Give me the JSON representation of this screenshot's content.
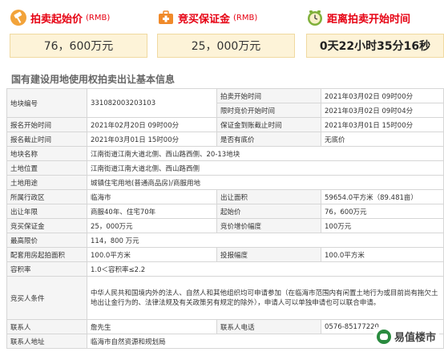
{
  "cards": [
    {
      "label": "拍卖起始价",
      "sub": "(RMB)",
      "value": "76，600万元",
      "icon": "gavel-icon"
    },
    {
      "label": "竞买保证金",
      "sub": "(RMB)",
      "value": "25，000万元",
      "icon": "medical-kit-icon"
    },
    {
      "label": "距离拍卖开始时间",
      "sub": "",
      "value": "0天22小时35分16秒",
      "icon": "clock-icon"
    }
  ],
  "section_title": "国有建设用地使用权拍卖出让基本信息",
  "rows": [
    {
      "k1": "地块编号",
      "v1": "331082003203103",
      "k2": "拍卖开始时间",
      "v2": "2021年03月02日 09时00分"
    },
    {
      "k1": "",
      "v1": "",
      "k2": "限时竞价开始时间",
      "v2": "2021年03月02日 09时04分"
    },
    {
      "k1": "报名开始时间",
      "v1": "2021年02月20日 09时00分",
      "k2": "保证金到账截止时间",
      "v2": "2021年03月01日 15时00分"
    },
    {
      "k1": "报名截止时间",
      "v1": "2021年03月01日 15时00分",
      "k2": "是否有底价",
      "v2": "无底价"
    },
    {
      "k1": "地块名称",
      "v1": "江南街道江南大道北侧、西山路西侧、20-13地块"
    },
    {
      "k1": "土地位置",
      "v1": "江南街道江南大道北侧、西山路西侧"
    },
    {
      "k1": "土地用途",
      "v1": "城镇住宅用地(普通商品房)/商服用地"
    },
    {
      "k1": "所属行政区",
      "v1": "临海市",
      "k2": "出让面积",
      "v2": "59654.0平方米（89.481亩）"
    },
    {
      "k1": "出让年限",
      "v1": "商服40年、住宅70年",
      "k2": "起始价",
      "v2": "76，600万元"
    },
    {
      "k1": "竞买保证金",
      "v1": "25，000万元",
      "k2": "竞价增价幅度",
      "v2": "100万元"
    },
    {
      "k1": "最高限价",
      "v1": "114，800 万元"
    },
    {
      "k1": "配套用房起拍面积",
      "v1": "100.0平方米",
      "k2": "投报幅度",
      "v2": "100.0平方米"
    },
    {
      "k1": "容积率",
      "v1": "1.0＜容积率≤2.2"
    },
    {
      "k1": "竞买人条件",
      "v1": "中华人民共和国境内外的法人、自然人和其他组织均可申请参加（在临海市范围内有闲置土地行为或目前尚有拖欠土地出让金行为的、法律法规及有关政策另有规定的除外），申请人可以单独申请也可以联合申请。"
    },
    {
      "k1": "联系人",
      "v1": "詹先生",
      "k2": "联系人电话",
      "v2": "0576-85177220"
    },
    {
      "k1": "联系人地址",
      "v1": "临海市自然资源和规划局"
    }
  ],
  "watermark": "易值楼市",
  "colors": {
    "accent": "#e60012",
    "card_bg": "#fdf3d8",
    "header_bg": "#f5f5f5"
  }
}
